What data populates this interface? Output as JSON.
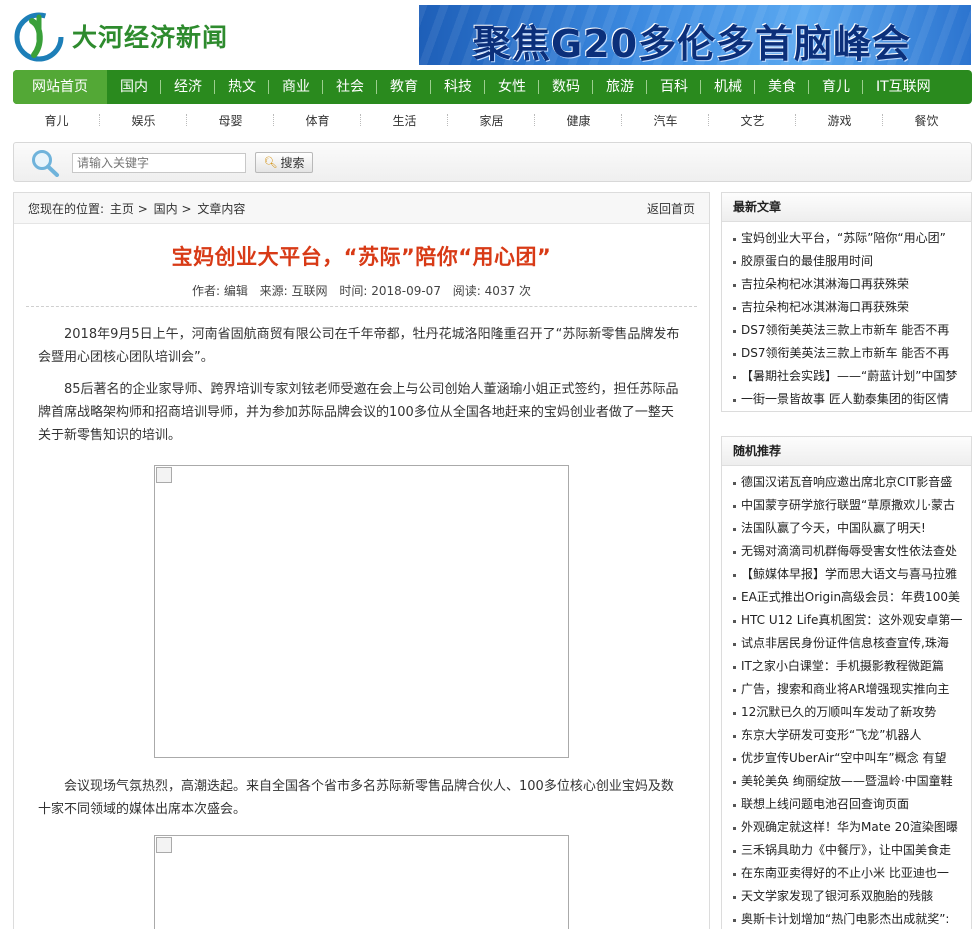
{
  "site": {
    "name": "大河经济新闻"
  },
  "banner": {
    "text": "聚焦G20多伦多首脑峰会"
  },
  "nav": {
    "main": [
      "网站首页",
      "国内",
      "经济",
      "热文",
      "商业",
      "社会",
      "教育",
      "科技",
      "女性",
      "数码",
      "旅游",
      "百科",
      "机械",
      "美食",
      "育儿",
      "IT互联网"
    ],
    "sub": [
      "育儿",
      "娱乐",
      "母婴",
      "体育",
      "生活",
      "家居",
      "健康",
      "汽车",
      "文艺",
      "游戏",
      "餐饮"
    ]
  },
  "search": {
    "placeholder": "请输入关键字",
    "button": "搜索"
  },
  "breadcrumb": {
    "prefix": "您现在的位置:",
    "home": "主页",
    "sep1": ">",
    "section": "国内",
    "sep2": ">",
    "current": "文章内容",
    "back": "返回首页"
  },
  "article": {
    "title": "宝妈创业大平台，“苏际”陪你“用心团”",
    "author": "作者: 编辑",
    "source": "来源: 互联网",
    "time": "时间: 2018-09-07",
    "reads": "阅读: 4037 次",
    "paragraphs": [
      "2018年9月5日上午，河南省固航商贸有限公司在千年帝都，牡丹花城洛阳隆重召开了“苏际新零售品牌发布会暨用心团核心团队培训会”。",
      "85后著名的企业家导师、跨界培训专家刘铉老师受邀在会上与公司创始人董涵瑜小姐正式签约，担任苏际品牌首席战略架构师和招商培训导师，并为参加苏际品牌会议的100多位从全国各地赶来的宝妈创业者做了一整天关于新零售知识的培训。",
      "会议现场气氛热烈，高潮迭起。来自全国各个省市多名苏际新零售品牌合伙人、100多位核心创业宝妈及数十家不同领域的媒体出席本次盛会。"
    ]
  },
  "sidebar": {
    "latest": {
      "title": "最新文章",
      "items": [
        "宝妈创业大平台，“苏际”陪你“用心团”",
        "胶原蛋白的最佳服用时间",
        "吉拉朵枸杞冰淇淋海口再获殊荣",
        "吉拉朵枸杞冰淇淋海口再获殊荣",
        "DS7领衔美英法三款上市新车 能否不再",
        "DS7领衔美英法三款上市新车 能否不再",
        "【暑期社会实践】——“蔚蓝计划”中国梦",
        "一街一景皆故事 匠人勤泰集团的街区情"
      ]
    },
    "random": {
      "title": "随机推荐",
      "items": [
        "德国汉诺瓦音响应邀出席北京CIT影音盛",
        "中国蒙亨研学旅行联盟“草原撒欢儿·蒙古",
        "法国队赢了今天，中国队赢了明天!",
        "无锡对滴滴司机群侮辱受害女性依法查处",
        "【鲸媒体早报】学而思大语文与喜马拉雅",
        "EA正式推出Origin高级会员：年费100美",
        "HTC U12 Life真机图赏：这外观安卓第一",
        "试点非居民身份证件信息核查宣传,珠海",
        "IT之家小白课堂：手机摄影教程微距篇",
        "广告，搜索和商业将AR增强现实推向主",
        "12沉默已久的万顺叫车发动了新攻势",
        "东京大学研发可变形“飞龙”机器人",
        "优步宣传UberAir“空中叫车”概念 有望",
        "美轮美奂 绚丽绽放——暨温岭·中国童鞋",
        "联想上线问题电池召回查询页面",
        "外观确定就这样！华为Mate 20渲染图曝",
        "三禾锅具助力《中餐厅》，让中国美食走",
        "在东南亚卖得好的不止小米 比亚迪也一",
        "天文学家发现了银河系双胞胎的残骸",
        "奥斯卡计划增加“热门电影杰出成就奖”:"
      ]
    }
  },
  "colors": {
    "nav_green": "#2a8a1e",
    "nav_active": "#53a836",
    "title_red": "#d83a16",
    "logo_green": "#2e8b2e"
  },
  "icons": {
    "logo": "logo-icon",
    "search": "search-icon",
    "broken_image": "broken-image-icon"
  }
}
